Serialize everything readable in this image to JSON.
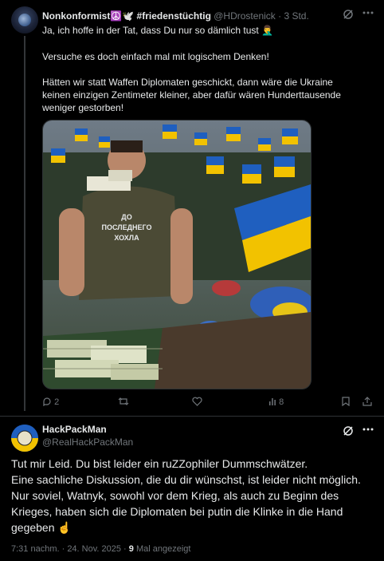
{
  "tweet": {
    "author_name": "Nonkonformist☮️🕊️ #friedenstüchtig",
    "handle": "@HDrostenick",
    "time": "· 3 Std.",
    "lines": [
      "Ja, ich hoffe in der Tat, dass Du nur so dämlich tust 🤦‍♂️",
      "Versuche es doch einfach mal mit logischem Denken!",
      "Hätten wir statt Waffen Diplomaten geschickt, dann wäre die Ukraine",
      "keinen einzigen Zentimeter kleiner, aber dafür wären Hunderttausende",
      "weniger gestorben!"
    ],
    "image_shirt_text": [
      "ДО",
      "ПОСЛЕДНЕГО",
      "ХОХЛА"
    ],
    "actions": {
      "reply_count": "2",
      "views_count": "8"
    }
  },
  "reply": {
    "author_name": "HackPackMan",
    "handle": "@RealHackPackMan",
    "lines": [
      "Tut mir Leid. Du bist leider ein ruZZophiler Dummschwätzer.",
      "Eine sachliche Diskussion, die du dir wünschst, ist leider nicht möglich.",
      "Nur soviel, Watnyk, sowohl vor dem Krieg, als auch zu Beginn des",
      "Krieges, haben sich die Diplomaten bei putin die Klinke in die Hand",
      "gegeben ☝️"
    ],
    "timestamp": "7:31 nachm. · 24. Nov. 2025 ·",
    "views_number": "9",
    "views_label": "Mal angezeigt"
  },
  "icons": {
    "grok": "grok-icon",
    "more": "more-icon",
    "reply": "reply-icon",
    "retweet": "retweet-icon",
    "like": "like-icon",
    "views": "views-icon",
    "bookmark": "bookmark-icon",
    "share": "share-icon"
  },
  "colors": {
    "background": "#000000",
    "text": "#e7e9ea",
    "secondary": "#71767b",
    "divider": "#2f3336",
    "flag_blue": "#1f5fbf",
    "flag_yellow": "#f2c200"
  }
}
